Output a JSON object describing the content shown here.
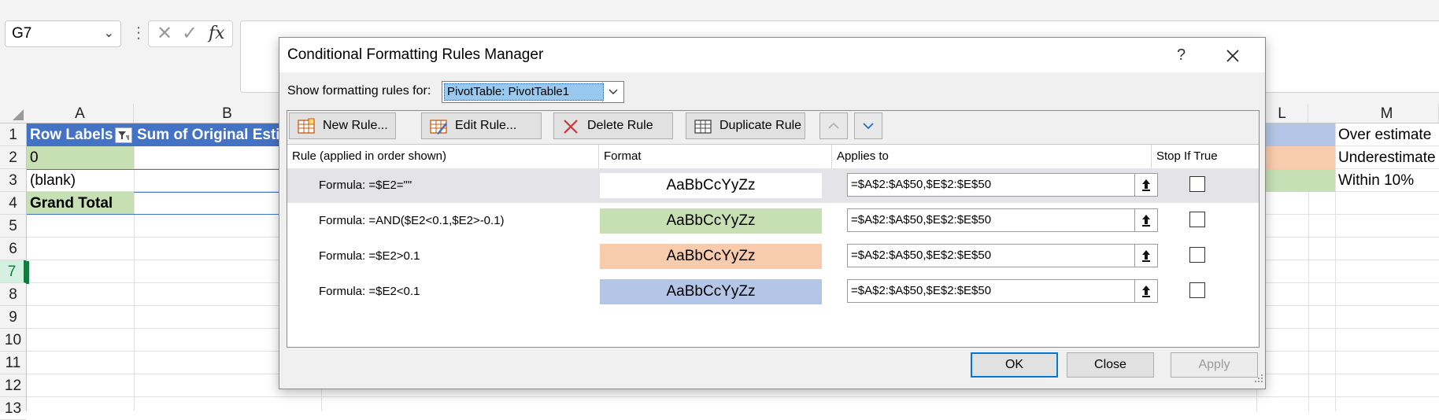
{
  "excel": {
    "namebox": "G7",
    "formula_icons": [
      "cancel-icon",
      "enter-icon",
      "fx-icon"
    ],
    "columns": [
      "A",
      "B",
      "L",
      "M"
    ],
    "rows": [
      "1",
      "2",
      "3",
      "4",
      "5",
      "6",
      "7",
      "8",
      "9",
      "10",
      "11",
      "12",
      "13"
    ],
    "selected_row": "7",
    "cells": {
      "A1": "Row Labels",
      "B1": "Sum of Original Esti",
      "A2": "0",
      "A3": "(blank)",
      "A4": "Grand Total",
      "M1": "Over estimate",
      "M2": "Underestimate",
      "M3": "Within 10%"
    },
    "colors": {
      "pivot_header": "#4472c4",
      "green": "#c6e0b4",
      "peach": "#f8cbad",
      "blue": "#b4c6e7",
      "selected": "#107c41"
    }
  },
  "dialog": {
    "title": "Conditional Formatting Rules Manager",
    "help": "?",
    "show_label": "Show formatting rules for:",
    "show_value": "PivotTable: PivotTable1",
    "toolbar": {
      "new_rule": "New Rule...",
      "edit_rule": "Edit Rule...",
      "delete_rule": "Delete Rule",
      "duplicate_rule": "Duplicate Rule"
    },
    "columns": {
      "rule": "Rule (applied in order shown)",
      "format": "Format",
      "applies_to": "Applies to",
      "stop_if_true": "Stop If True"
    },
    "rules": [
      {
        "rule": "Formula: =$E2=\"\"",
        "preview": "AaBbCcYyZz",
        "fill": "#ffffff",
        "applies_to": "=$A$2:$A$50,$E$2:$E$50",
        "stop_if_true": false
      },
      {
        "rule": "Formula: =AND($E2<0.1,$E2>-0.1)",
        "preview": "AaBbCcYyZz",
        "fill": "#c6e0b4",
        "applies_to": "=$A$2:$A$50,$E$2:$E$50",
        "stop_if_true": false
      },
      {
        "rule": "Formula: =$E2>0.1",
        "preview": "AaBbCcYyZz",
        "fill": "#f8cbad",
        "applies_to": "=$A$2:$A$50,$E$2:$E$50",
        "stop_if_true": false
      },
      {
        "rule": "Formula: =$E2<0.1",
        "preview": "AaBbCcYyZz",
        "fill": "#b4c6e7",
        "applies_to": "=$A$2:$A$50,$E$2:$E$50",
        "stop_if_true": false
      }
    ],
    "buttons": {
      "ok": "OK",
      "close": "Close",
      "apply": "Apply"
    }
  }
}
